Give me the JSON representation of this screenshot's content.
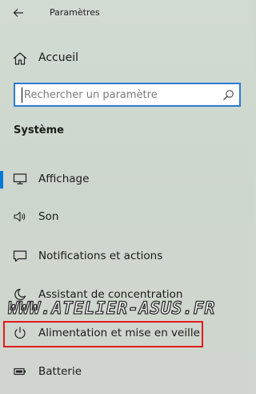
{
  "window": {
    "title": "Paramètres"
  },
  "home": {
    "label": "Accueil",
    "icon": "home-icon"
  },
  "search": {
    "placeholder": "Rechercher un paramètre",
    "value": "",
    "icon": "search-icon",
    "accent_color": "#2b7cd3"
  },
  "section": {
    "heading": "Système"
  },
  "nav": {
    "items": [
      {
        "label": "Affichage",
        "icon": "display-icon",
        "selected": true
      },
      {
        "label": "Son",
        "icon": "speaker-icon",
        "selected": false
      },
      {
        "label": "Notifications et actions",
        "icon": "notification-icon",
        "selected": false
      },
      {
        "label": "Assistant de concentration",
        "icon": "moon-icon",
        "selected": false
      },
      {
        "label": "Alimentation et mise en veille",
        "icon": "power-icon",
        "selected": false,
        "highlighted": true
      },
      {
        "label": "Batterie",
        "icon": "battery-icon",
        "selected": false
      }
    ],
    "selection_color": "#0078d7",
    "highlight_color": "#e01b1b"
  },
  "watermark": {
    "text": "WWW.ATELIER-ASUS.FR"
  }
}
